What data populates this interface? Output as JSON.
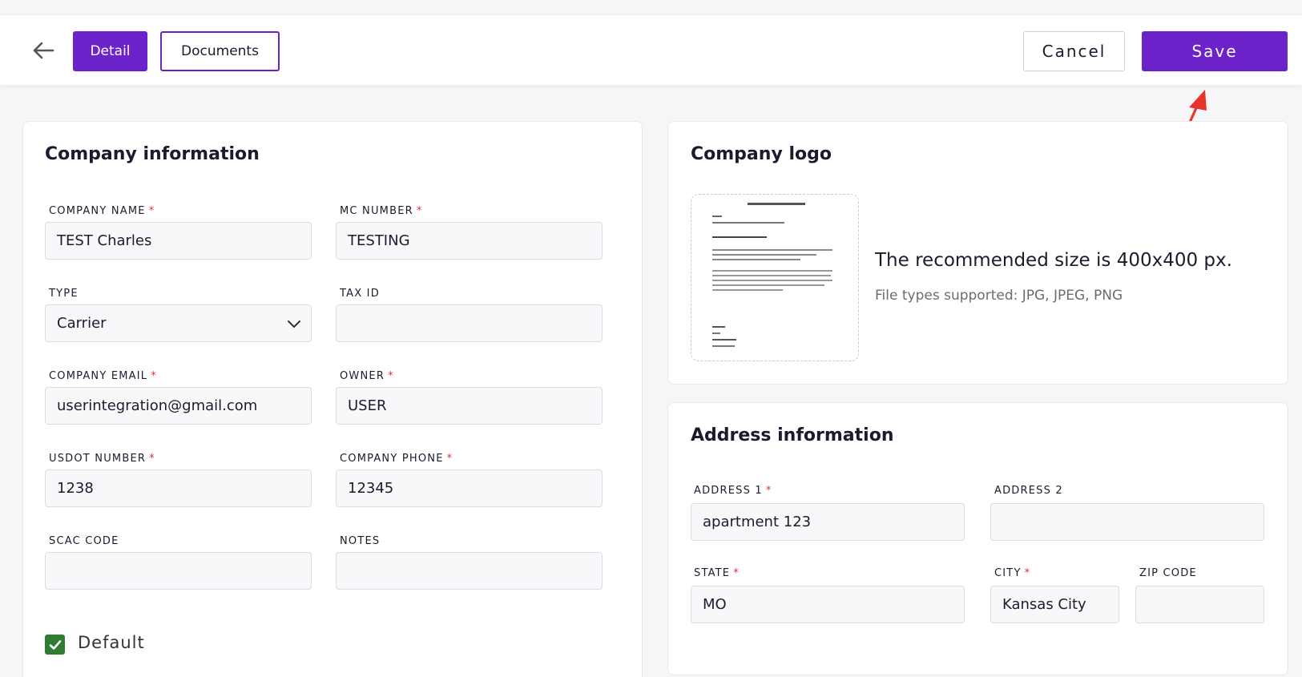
{
  "header": {
    "back_icon": "arrow-left-icon",
    "tabs": {
      "detail": "Detail",
      "documents": "Documents"
    },
    "cancel_label": "Cancel",
    "save_label": "Save"
  },
  "colors": {
    "accent": "#6c22c9",
    "required": "#e0303a",
    "checkbox": "#2e7d32",
    "annotation_arrow": "#e8352b"
  },
  "company": {
    "title": "Company information",
    "fields": {
      "company_name": {
        "label": "COMPANY NAME",
        "value": "TEST Charles",
        "required": "*"
      },
      "mc_number": {
        "label": "MC NUMBER",
        "value": "TESTING",
        "required": "*"
      },
      "type": {
        "label": "TYPE",
        "value": "Carrier"
      },
      "tax_id": {
        "label": "TAX ID",
        "value": ""
      },
      "company_email": {
        "label": "COMPANY EMAIL",
        "value": "userintegration@gmail.com",
        "required": "*"
      },
      "owner": {
        "label": "OWNER",
        "value": "USER",
        "required": "*"
      },
      "usdot_number": {
        "label": "USDOT NUMBER",
        "value": "1238",
        "required": "*"
      },
      "company_phone": {
        "label": "COMPANY PHONE",
        "value": "12345",
        "required": "*"
      },
      "scac_code": {
        "label": "SCAC CODE",
        "value": ""
      },
      "notes": {
        "label": "NOTES",
        "value": ""
      }
    },
    "default_label": "Default",
    "default_checked": true
  },
  "logo": {
    "title": "Company logo",
    "recommended": "The recommended size is 400x400 px.",
    "file_types": "File types supported: JPG, JPEG, PNG"
  },
  "address": {
    "title": "Address information",
    "fields": {
      "address1": {
        "label": "ADDRESS 1",
        "value": "apartment 123",
        "required": "*"
      },
      "address2": {
        "label": "ADDRESS 2",
        "value": ""
      },
      "state": {
        "label": "STATE",
        "value": "MO",
        "required": "*"
      },
      "city": {
        "label": "CITY",
        "value": "Kansas City",
        "required": "*"
      },
      "zip": {
        "label": "ZIP CODE",
        "value": ""
      }
    }
  }
}
